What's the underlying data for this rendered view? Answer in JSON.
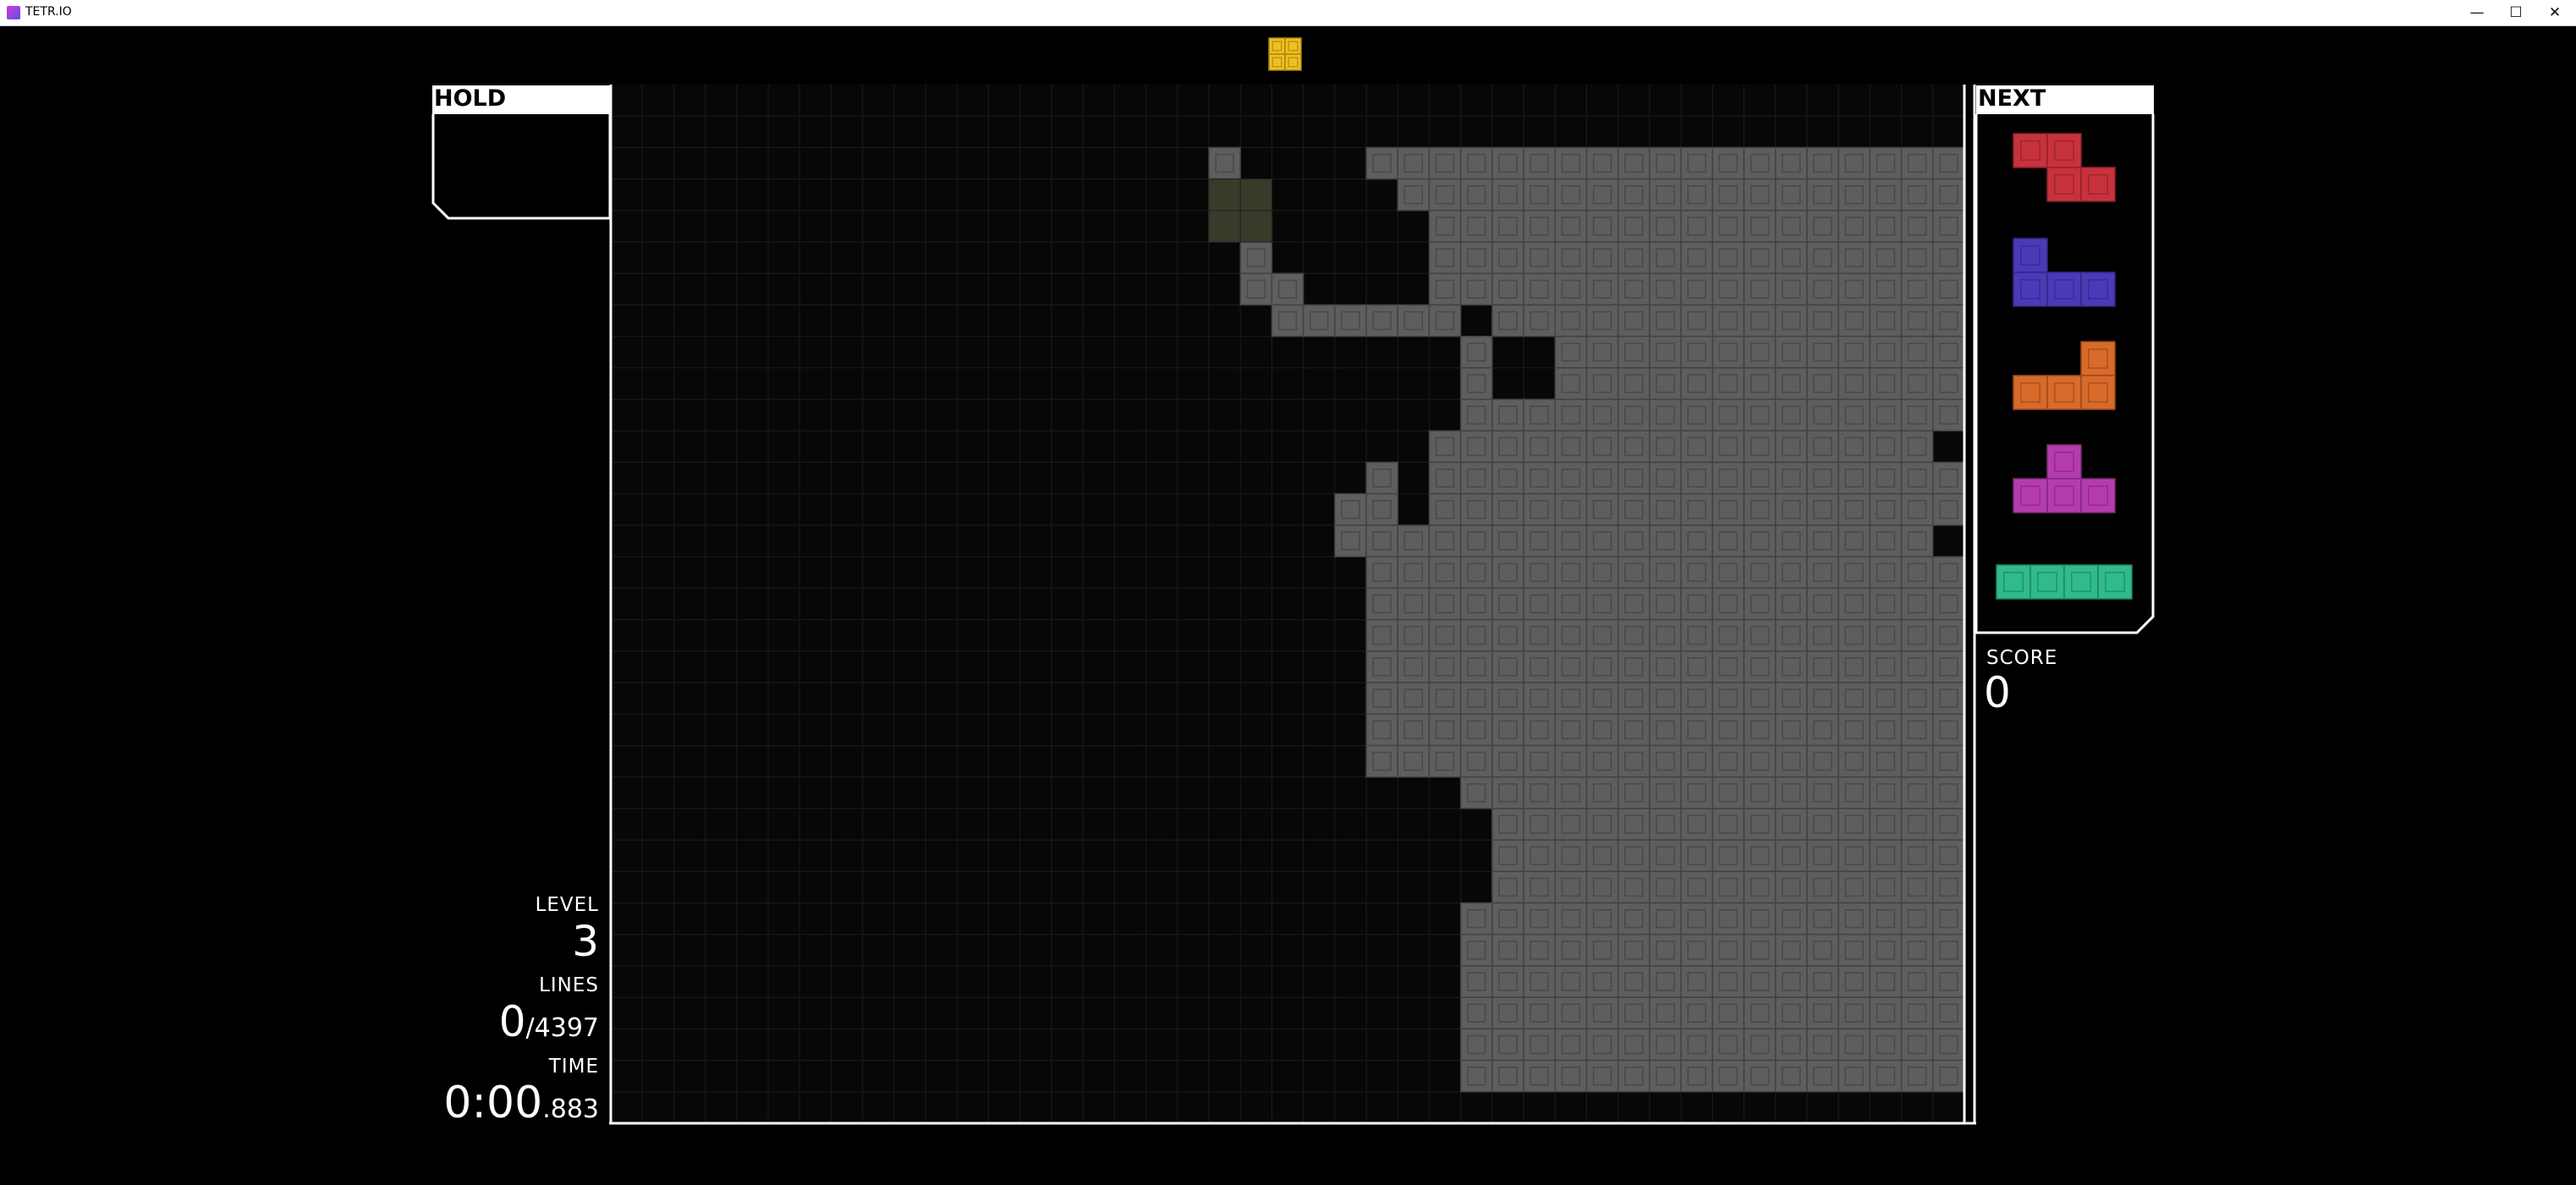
{
  "window": {
    "title": "TETR.IO",
    "minimize_glyph": "—",
    "maximize_glyph": "☐",
    "close_glyph": "✕"
  },
  "hold": {
    "label": "HOLD",
    "piece": null
  },
  "next": {
    "label": "NEXT",
    "queue": [
      {
        "piece": "Z",
        "color": "#c8323c"
      },
      {
        "piece": "J",
        "color": "#4a3ab8"
      },
      {
        "piece": "L",
        "color": "#d86a2a"
      },
      {
        "piece": "T",
        "color": "#b53cb0"
      },
      {
        "piece": "I",
        "color": "#2fbb8a"
      }
    ]
  },
  "active_piece": {
    "piece": "O",
    "color": "#f0c020"
  },
  "stats": {
    "level_label": "LEVEL",
    "level": "3",
    "lines_label": "LINES",
    "lines_current": "0",
    "lines_sep": "/",
    "lines_total": "4397",
    "time_label": "TIME",
    "time_main": "0:00",
    "time_ms": ".883",
    "score_label": "SCORE",
    "score": "0"
  },
  "board": {
    "columns": 43,
    "rows": 33,
    "garbage_color": "#5e5e5e",
    "ghost_color": "#3a3a2a",
    "cells": [
      "..........................................",
      "..........................................",
      "...................*....*******************",
      "...................*.....******************",
      "...................**.....*****************",
      "....................*.....*****************",
      "....................**....*****************",
      ".....................******.****************",
      "...........................*..*************",
      "...........................*..*************",
      "...........................****************",
      "..........................****************.",
      "........................*.*****************",
      ".......................**.*****************",
      ".......................*******************.",
      "........................*******************",
      "........................*******************",
      "........................*******************",
      "........................*******************",
      "........................*******************",
      "........................*******************",
      "........................*******************",
      "...........................****************",
      "............................***************",
      "............................***************",
      "............................***************",
      "...........................****************",
      "...........................****************",
      "...........................****************",
      "...........................****************",
      "...........................****************",
      "...........................****************",
      "..........................................."
    ]
  }
}
